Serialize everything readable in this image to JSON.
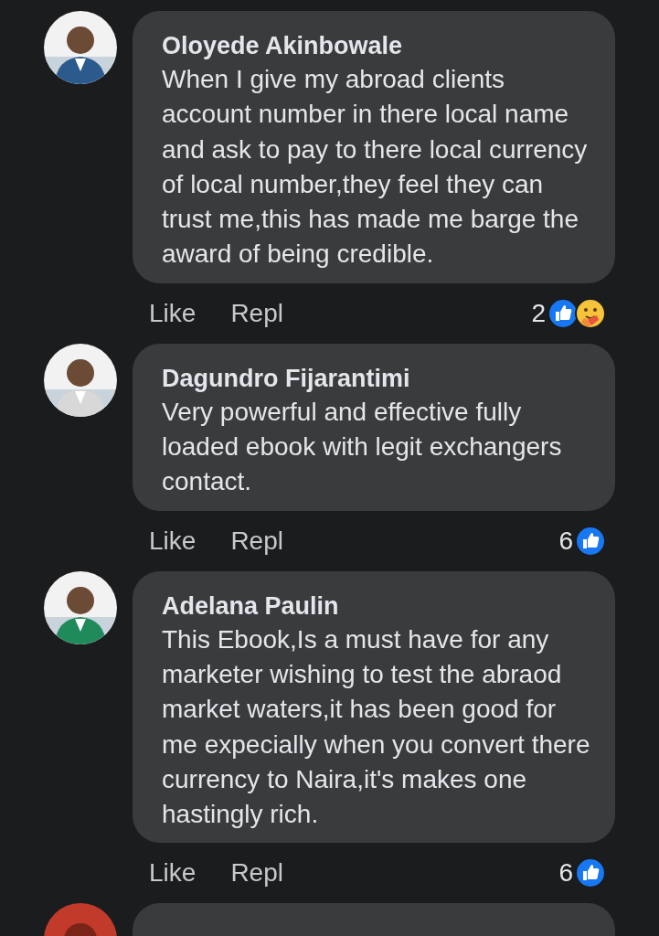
{
  "comments": [
    {
      "name": "Oloyede Akinbowale",
      "text": "When I give my abroad clients account number in there local name and ask to pay to there local currency of local number,they feel they can trust me,this has made me barge the award of being credible.",
      "actions": [
        "Like",
        "Repl"
      ],
      "reaction_count": "2",
      "reactions": [
        {
          "kind": "like"
        },
        {
          "kind": "care"
        }
      ]
    },
    {
      "name": "Dagundro Fijarantimi",
      "text": "Very powerful and effective fully loaded ebook with legit exchangers contact.",
      "actions": [
        "Like",
        "Repl"
      ],
      "reaction_count": "6",
      "reactions": [
        {
          "kind": "like"
        }
      ]
    },
    {
      "name": "Adelana Paulin",
      "text": "This Ebook,Is a must have for any marketer wishing to test the abraod market waters,it has been good for me expecially when you convert there currency to Naira,it's makes one hastingly rich.",
      "actions": [
        "Like",
        "Repl"
      ],
      "reaction_count": "6",
      "reactions": [
        {
          "kind": "like"
        }
      ]
    }
  ]
}
